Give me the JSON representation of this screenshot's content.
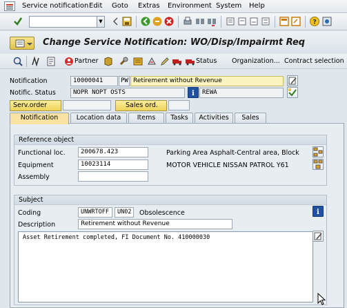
{
  "menu": {
    "items": [
      "Service notification",
      "Edit",
      "Goto",
      "Extras",
      "Environment",
      "System",
      "Help"
    ]
  },
  "toolbar": {
    "command_field_value": ""
  },
  "title": {
    "text": "Change Service Notification: WO/Disp/Impairmt Req"
  },
  "app_toolbar": {
    "partner_label": "Partner",
    "status_label": "Status",
    "organization_label": "Organization...",
    "contract_label": "Contract selection"
  },
  "header": {
    "notification_label": "Notification",
    "notification_number": "10000041",
    "notification_type": "PW",
    "notification_description": "Retirement without Revenue",
    "status_label": "Notific. Status",
    "status_value": "NOPR NOPT OSTS",
    "status_user": "REWA",
    "serv_order_button": "Serv.order",
    "sales_ord_button": "Sales ord."
  },
  "tabs": [
    {
      "label": "Notification",
      "active": true
    },
    {
      "label": "Location data",
      "active": false
    },
    {
      "label": "Items",
      "active": false
    },
    {
      "label": "Tasks",
      "active": false
    },
    {
      "label": "Activities",
      "active": false
    },
    {
      "label": "Sales",
      "active": false
    }
  ],
  "reference_object": {
    "group_title": "Reference object",
    "functional_loc_label": "Functional loc.",
    "functional_loc_value": "200678.423",
    "functional_loc_desc": "Parking Area Asphalt-Central area, Block",
    "equipment_label": "Equipment",
    "equipment_value": "10023114",
    "equipment_desc": "MOTOR VEHICLE NISSAN PATROL Y61",
    "assembly_label": "Assembly",
    "assembly_value": ""
  },
  "subject": {
    "group_title": "Subject",
    "coding_label": "Coding",
    "coding_group": "UNWRTOFF",
    "coding_code": "UN02",
    "coding_desc": "Obsolescence",
    "description_label": "Description",
    "description_value": "Retirement without Revenue",
    "long_text": "Asset Retirement completed, FI Document No. 410000030"
  },
  "colors": {
    "tab_active": "#f9e3a3",
    "button_yellow": "#efd45a",
    "background": "#dfe6ec"
  }
}
